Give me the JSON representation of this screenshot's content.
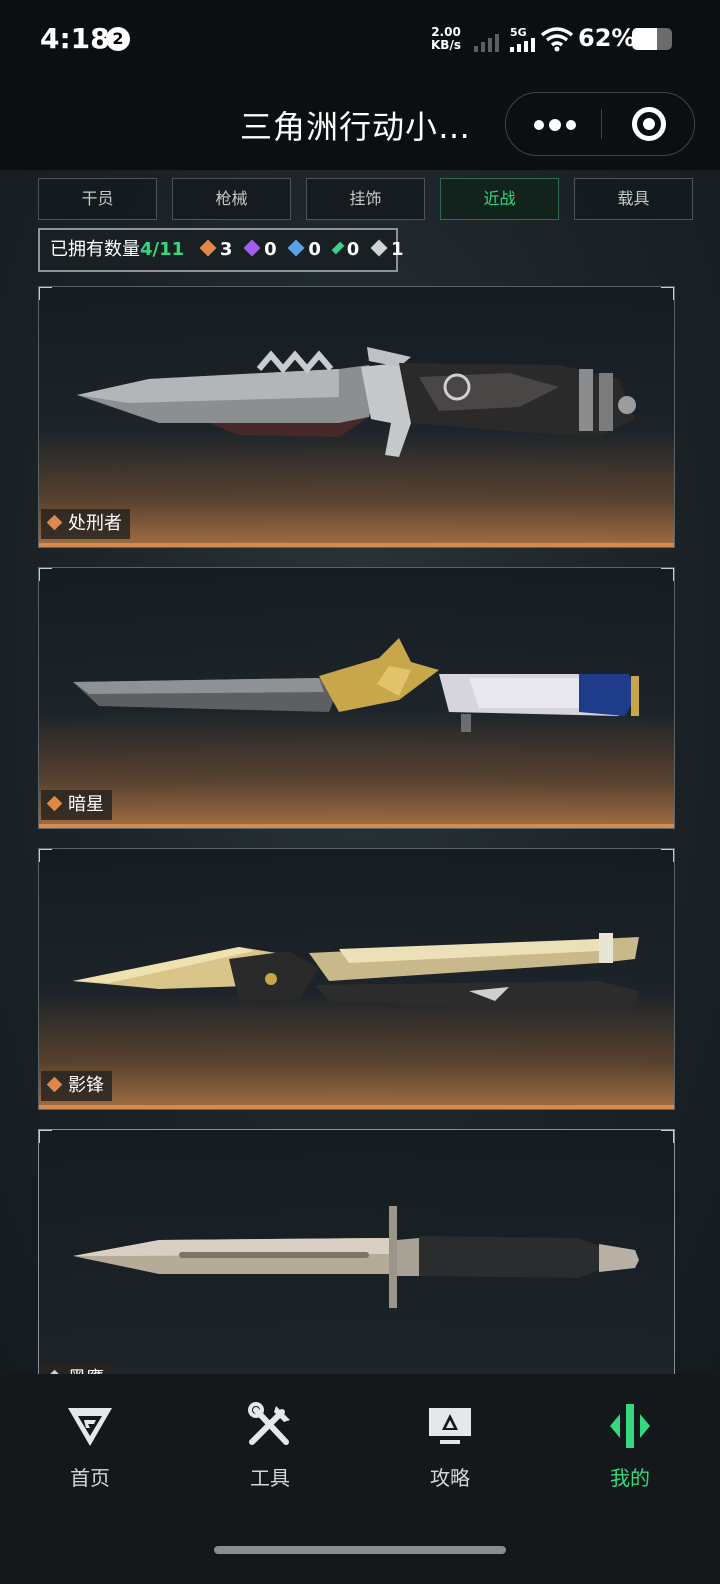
{
  "status_bar": {
    "time": "4:18",
    "notification_count": "2",
    "net_speed_value": "2.00",
    "net_speed_unit": "KB/s",
    "network_type": "5G",
    "battery_percent": "62%",
    "battery_level": 0.62
  },
  "title_bar": {
    "title": "三角洲行动小…"
  },
  "tabs": [
    {
      "label": "干员",
      "active": false
    },
    {
      "label": "枪械",
      "active": false
    },
    {
      "label": "挂饰",
      "active": false
    },
    {
      "label": "近战",
      "active": true
    },
    {
      "label": "载具",
      "active": false
    }
  ],
  "owned": {
    "label": "已拥有数量",
    "count": "4/11",
    "rarities": [
      {
        "count": "3",
        "color": "#e0884a",
        "icon": "orange-gem-icon"
      },
      {
        "count": "0",
        "color": "#a35cf0",
        "icon": "purple-gem-icon"
      },
      {
        "count": "0",
        "color": "#5aa0e6",
        "icon": "blue-gem-icon"
      },
      {
        "count": "0",
        "color": "#3fd08a",
        "icon": "green-gem-icon"
      },
      {
        "count": "1",
        "color": "#cfd3d5",
        "icon": "white-gem-icon"
      }
    ]
  },
  "items": [
    {
      "name": "处刑者",
      "rarity": "orange"
    },
    {
      "name": "暗星",
      "rarity": "orange"
    },
    {
      "name": "影锋",
      "rarity": "orange"
    },
    {
      "name": "黑鹰",
      "rarity": "white"
    }
  ],
  "bottom_nav": [
    {
      "label": "首页",
      "icon": "home-logo-icon",
      "active": false
    },
    {
      "label": "工具",
      "icon": "tools-icon",
      "active": false
    },
    {
      "label": "攻略",
      "icon": "guide-monitor-icon",
      "active": false
    },
    {
      "label": "我的",
      "icon": "profile-logo-icon",
      "active": true
    }
  ],
  "colors": {
    "accent": "#35d87f",
    "orange_rarity": "#e0884a"
  }
}
